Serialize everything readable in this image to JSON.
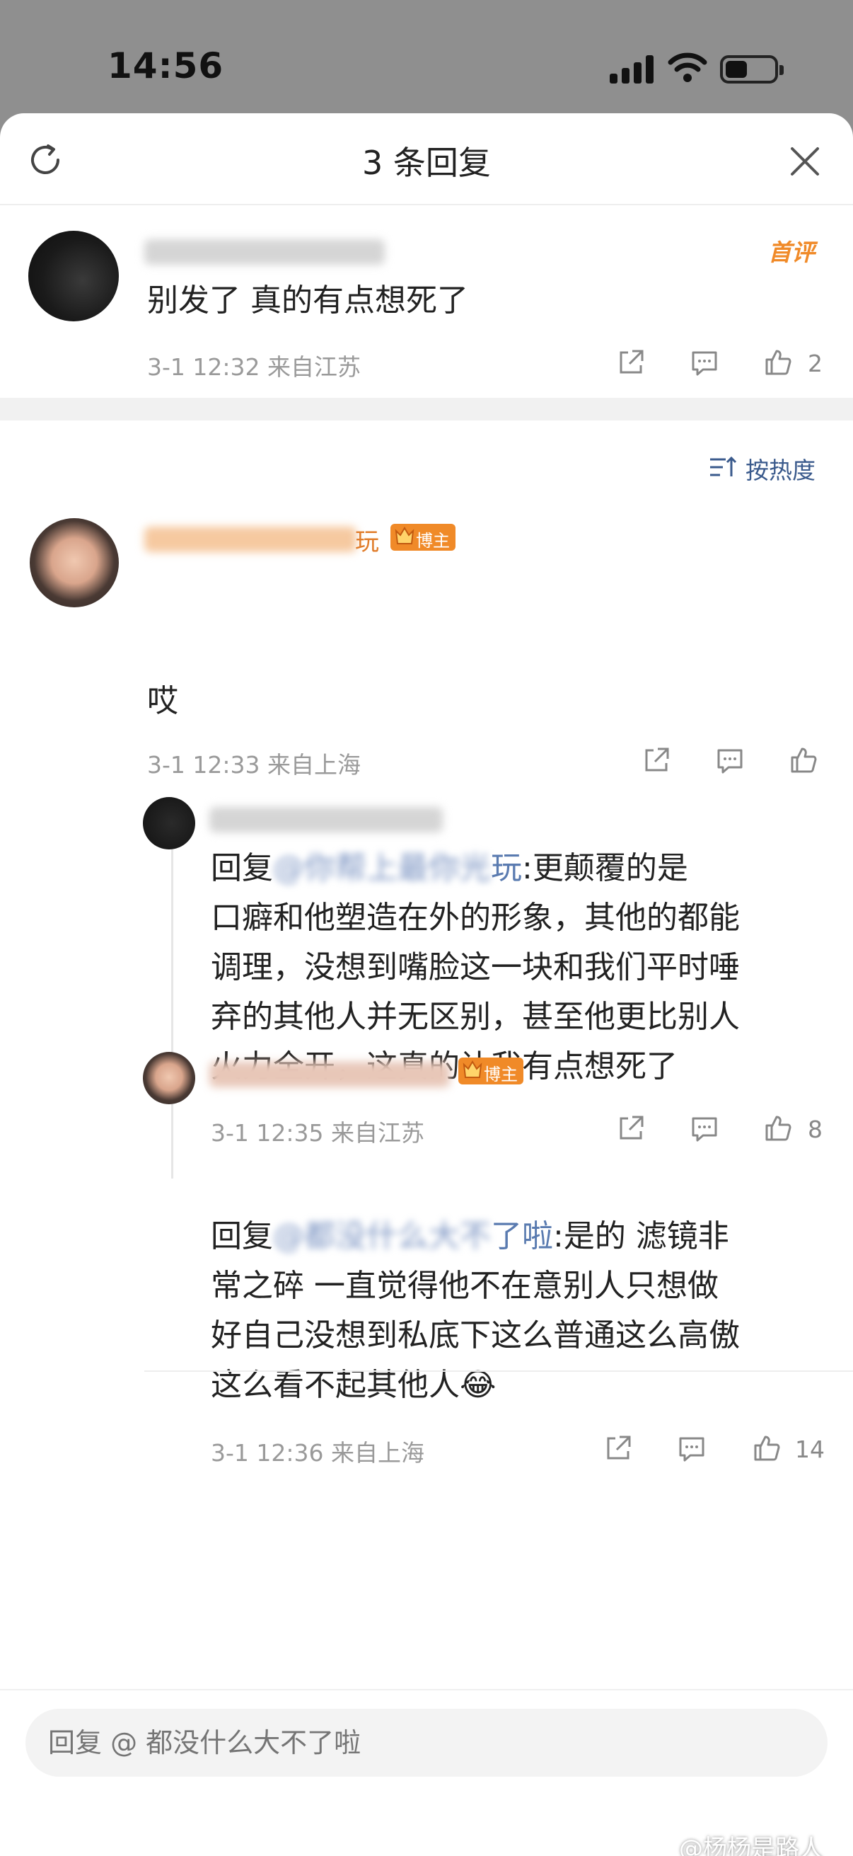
{
  "status": {
    "time": "14:56"
  },
  "header": {
    "title": "3 条回复"
  },
  "main_comment": {
    "tag": "首评",
    "text": "别发了  真的有点想死了",
    "meta": "3-1 12:32  来自江苏",
    "likes": "2"
  },
  "sort": {
    "label": "按热度"
  },
  "comment1": {
    "name_tail": "玩",
    "badge": "博主",
    "text": "哎",
    "meta": "3-1 12:33  来自上海"
  },
  "reply1": {
    "prefix": "回复",
    "mention_tail": "玩",
    "lines": [
      ":更颠覆的是",
      "口癖和他塑造在外的形象，其他的都能",
      "调理，没想到嘴脸这一块和我们平时唾",
      "弃的其他人并无区别，甚至他更比别人",
      "火力全开，这真的让我有点想死了"
    ],
    "meta": "3-1 12:35  来自江苏",
    "likes": "8"
  },
  "reply2": {
    "badge": "博主",
    "prefix": "回复",
    "mention_tail": "了啦",
    "lines": [
      ":是的 滤镜非",
      "常之碎 一直觉得他不在意别人只想做",
      "好自己没想到私底下这么普通这么高傲",
      "这么看不起其他人"
    ],
    "emoji": "😂",
    "meta": "3-1 12:36  来自上海",
    "likes": "14"
  },
  "input": {
    "placeholder": "回复 @ 都没什么大不了啦"
  },
  "watermark": "@杨杨是路人"
}
